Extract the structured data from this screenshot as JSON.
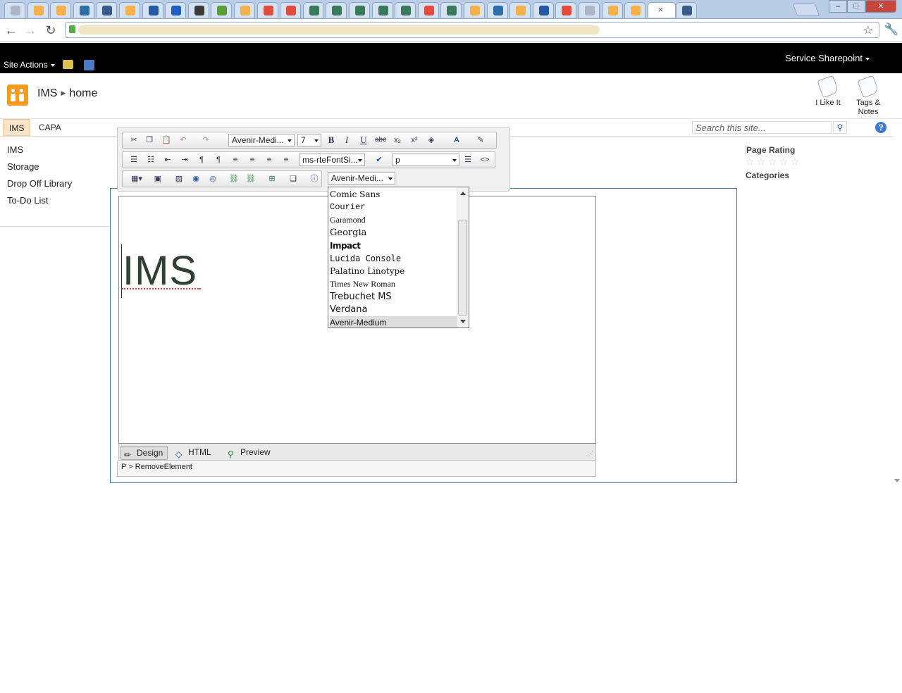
{
  "browser": {
    "tabs_count": 30,
    "tab_colors": [
      "#aab7c8",
      "#f4b04a",
      "#f4b04a",
      "#2f6fa8",
      "#3a5a8a",
      "#f4b04a",
      "#2457a5",
      "#1f5fbf",
      "#3b3b3b",
      "#5a9e3a",
      "#f4b04a",
      "#e04c3c",
      "#e04c3c",
      "#3a7a5a",
      "#3a7a5a",
      "#3a7a5a",
      "#3a7a5a",
      "#3a7a5a",
      "#e04c3c",
      "#3a7a5a",
      "#f4b04a",
      "#2f6fa8",
      "#f4b04a",
      "#2457a5",
      "#e04c3c"
    ],
    "active_tab_close": "×",
    "window_controls": {
      "minimize": "–",
      "maximize": "□",
      "close": "✕"
    },
    "back": "←",
    "forward": "→",
    "reload": "↻",
    "bookmark_icon": "☆",
    "wrench_icon": "🔧"
  },
  "topbar": {
    "site_actions": "Site Actions",
    "user": "Service Sharepoint"
  },
  "header": {
    "breadcrumb": [
      "IMS",
      "home"
    ],
    "i_like_it": "I Like It",
    "tags_notes_line1": "Tags &",
    "tags_notes_line2": "Notes"
  },
  "topnav": {
    "items": [
      {
        "label": "IMS"
      },
      {
        "label": "CAPA"
      }
    ],
    "search_placeholder": "Search this site...",
    "help": "?"
  },
  "quicklaunch": {
    "items": [
      {
        "label": "IMS"
      },
      {
        "label": "Storage"
      },
      {
        "label": "Drop Off Library"
      },
      {
        "label": "To-Do List"
      }
    ]
  },
  "rightpanel": {
    "rating_label": "Page Rating",
    "stars": 5,
    "categories_label": "Categories"
  },
  "toolbar": {
    "font_name": "Avenir-Medi...",
    "font_size": "7",
    "style_class": "ms-rteFontSi...",
    "block_format": "p",
    "font_name2": "Avenir-Medi..."
  },
  "editor": {
    "content": "IMS",
    "modes": [
      {
        "label": "Design"
      },
      {
        "label": "HTML"
      },
      {
        "label": "Preview"
      }
    ],
    "status_path": "P > RemoveElement"
  },
  "font_dropdown": {
    "options": [
      {
        "label": "Comic Sans",
        "family": "\"DejaVu Serif\", serif"
      },
      {
        "label": "Courier",
        "family": "\"Liberation Mono\", monospace"
      },
      {
        "label": "Garamond",
        "family": "\"Liberation Serif\", serif"
      },
      {
        "label": "Georgia",
        "family": "\"DejaVu Serif\", serif"
      },
      {
        "label": "Impact",
        "family": "\"DejaVu Sans\", sans-serif"
      },
      {
        "label": "Lucida Console",
        "family": "\"DejaVu Sans Mono\", monospace"
      },
      {
        "label": "Palatino Linotype",
        "family": "\"DejaVu Serif\", serif"
      },
      {
        "label": "Times New Roman",
        "family": "\"Liberation Serif\", serif"
      },
      {
        "label": "Trebuchet MS",
        "family": "\"DejaVu Sans\", sans-serif"
      },
      {
        "label": "Verdana",
        "family": "\"DejaVu Sans\", sans-serif"
      },
      {
        "label": "Avenir-Medium",
        "family": "\"Liberation Sans\", sans-serif"
      }
    ],
    "selected": "Avenir-Medium"
  }
}
